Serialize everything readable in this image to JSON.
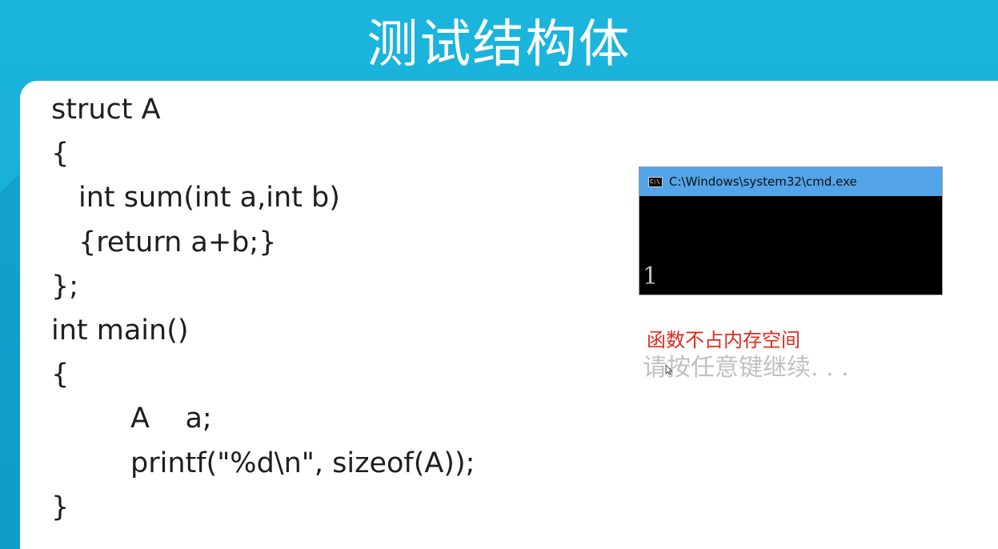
{
  "slide": {
    "title": "测试结构体",
    "accent_color": "#1aaed6"
  },
  "code": {
    "lines": [
      "struct A",
      "{",
      "int sum(int a,int b)",
      "{return a+b;}",
      "};",
      "int main()",
      "{",
      "A    a;",
      "printf(\"%d\\n\", sizeof(A));",
      "}"
    ]
  },
  "console": {
    "window_title": "C:\\Windows\\system32\\cmd.exe",
    "icon": "cmd-icon",
    "output_lines": [
      "1",
      "请按任意键继续. . ."
    ]
  },
  "note": {
    "text": "函数不占内存空间",
    "color": "#e02a1d"
  }
}
